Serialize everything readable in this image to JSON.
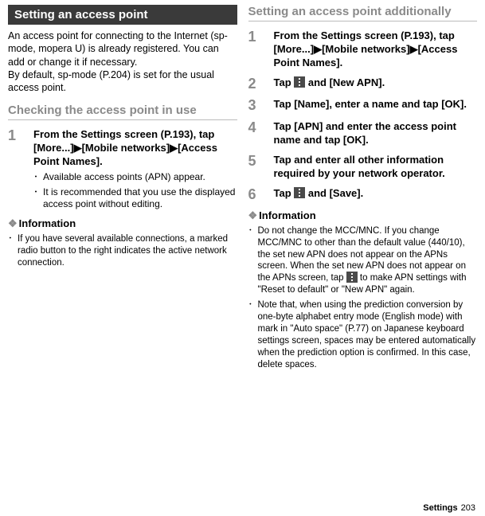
{
  "left": {
    "banner": "Setting an access point",
    "intro1": "An access point for connecting to the Internet (sp-mode, mopera U) is already registered. You can add or change it if necessary.",
    "intro2": "By default, sp-mode (P.204) is set for the usual access point.",
    "subhead": "Checking the access point in use",
    "step1_num": "1",
    "step1_line": "From the Settings screen (P.193), tap [More...]",
    "step1_arrow1": "▶",
    "step1_mid": "[Mobile networks]",
    "step1_arrow2": "▶",
    "step1_end": "[Access Point Names].",
    "step1_b1": "Available access points (APN) appear.",
    "step1_b2": "It is recommended that you use the displayed access point without editing.",
    "info_head": "Information",
    "info1": "If you have several available connections, a marked radio button to the right indicates the active network connection."
  },
  "right": {
    "subhead": "Setting an access point additionally",
    "s1_num": "1",
    "s1_a": "From the Settings screen (P.193), tap [More...]",
    "s1_arrow1": "▶",
    "s1_b": "[Mobile networks]",
    "s1_arrow2": "▶",
    "s1_c": "[Access Point Names].",
    "s2_num": "2",
    "s2_a": "Tap ",
    "s2_b": " and [New APN].",
    "s3_num": "3",
    "s3": "Tap [Name], enter a name and tap [OK].",
    "s4_num": "4",
    "s4": "Tap [APN] and enter the access point name and tap [OK].",
    "s5_num": "5",
    "s5": "Tap and enter all other information required by your network operator.",
    "s6_num": "6",
    "s6_a": "Tap ",
    "s6_b": " and [Save].",
    "info_head": "Information",
    "info1_a": "Do not change the MCC/MNC. If you change MCC/MNC to other than the default value (440/10), the set new APN does not appear on the APNs screen. When the set new APN does not appear on the APNs screen, tap ",
    "info1_b": " to make APN settings with \"Reset to default\" or \"New APN\" again.",
    "info2": "Note that, when using the prediction conversion by one-byte alphabet entry mode (English mode) with mark in \"Auto space\" (P.77) on Japanese keyboard settings screen, spaces may be entered automatically when the prediction option is confirmed. In this case, delete spaces."
  },
  "footer": {
    "section": "Settings",
    "page": "203"
  }
}
